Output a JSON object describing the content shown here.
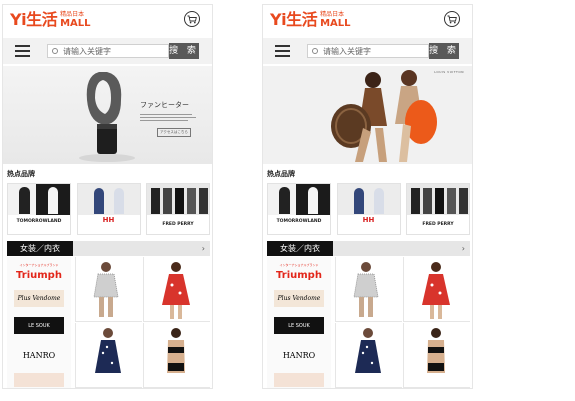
{
  "screens": [
    {
      "logo": {
        "main": "Yi生活",
        "sub": "精品日本",
        "mall": "MALL"
      },
      "search": {
        "placeholder": "请输入关键字",
        "button": "搜 索"
      },
      "banner": {
        "type": "product",
        "heading": "ファンヒーター",
        "button_text": "アクセスはこちら"
      },
      "brands_title": "热点品牌",
      "brands": [
        "TOMORROWLAND",
        "HH",
        "FRED PERRY"
      ],
      "category": {
        "label": "女装／内衣",
        "arrow": "›"
      },
      "brand_logos": [
        "Triumph",
        "Plus Vendome",
        "LE SOUK",
        "HANRO",
        ""
      ],
      "triumph_tag": "インターナショナルブランド"
    },
    {
      "logo": {
        "main": "Yi生活",
        "sub": "精品日本",
        "mall": "MALL"
      },
      "search": {
        "placeholder": "请输入关键字",
        "button": "搜 索"
      },
      "banner": {
        "type": "models",
        "brand": "LOUIS VUITTON"
      },
      "brands_title": "热点品牌",
      "brands": [
        "TOMORROWLAND",
        "HH",
        "FRED PERRY"
      ],
      "category": {
        "label": "女装／内衣",
        "arrow": "›"
      },
      "brand_logos": [
        "Triumph",
        "Plus Vendome",
        "LE SOUK",
        "HANRO",
        ""
      ],
      "triumph_tag": "インターナショナルブランド"
    }
  ],
  "colors": {
    "brand": "#e8491e",
    "dark": "#111111",
    "search_button": "#595959",
    "bar": "#e6e6e6",
    "triumph": "#e2261a"
  },
  "icons": [
    "cart-icon",
    "menu-icon",
    "search-icon",
    "chevron-right-icon"
  ]
}
